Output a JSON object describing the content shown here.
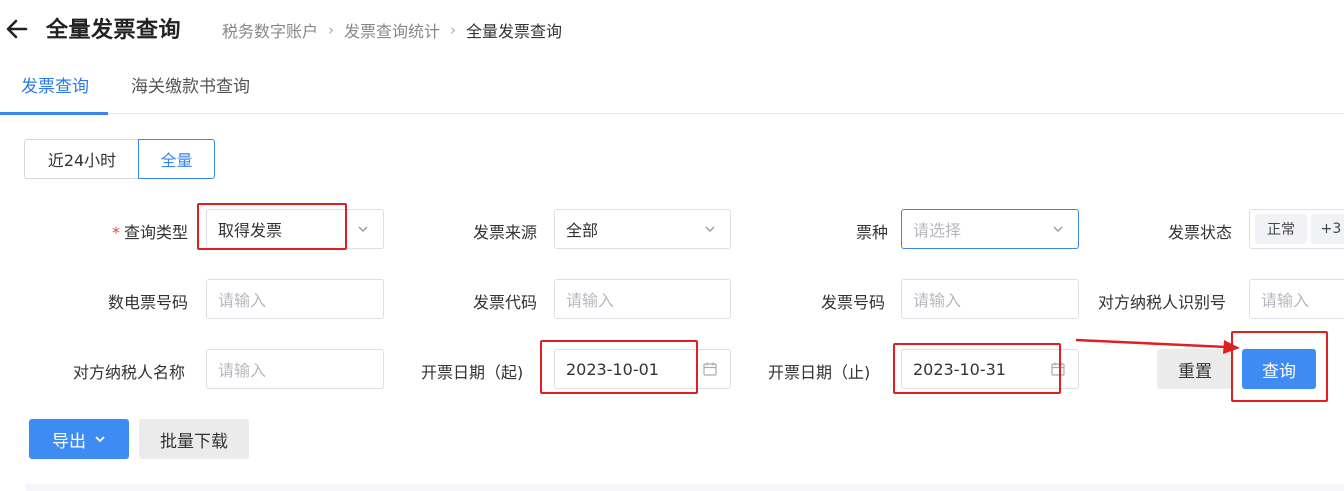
{
  "header": {
    "title": "全量发票查询",
    "breadcrumb": [
      "税务数字账户",
      "发票查询统计",
      "全量发票查询"
    ]
  },
  "tabs": [
    {
      "label": "发票查询",
      "active": true
    },
    {
      "label": "海关缴款书查询",
      "active": false
    }
  ],
  "time_range": {
    "options": [
      "近24小时",
      "全量"
    ],
    "selected": "全量"
  },
  "form": {
    "query_type": {
      "label": "查询类型",
      "required": true,
      "value": "取得发票"
    },
    "invoice_source": {
      "label": "发票来源",
      "value": "全部"
    },
    "ticket_type": {
      "label": "票种",
      "placeholder": "请选择"
    },
    "invoice_status": {
      "label": "发票状态",
      "tags": [
        "正常",
        "+3"
      ]
    },
    "e_invoice_no": {
      "label": "数电票号码",
      "placeholder": "请输入"
    },
    "invoice_code": {
      "label": "发票代码",
      "placeholder": "请输入"
    },
    "invoice_no": {
      "label": "发票号码",
      "placeholder": "请输入"
    },
    "counterparty_tax_id": {
      "label": "对方纳税人识别号",
      "placeholder": "请输入"
    },
    "counterparty_name": {
      "label": "对方纳税人名称",
      "placeholder": "请输入"
    },
    "issue_date_start": {
      "label": "开票日期（起)",
      "value": "2023-10-01"
    },
    "issue_date_end": {
      "label": "开票日期（止)",
      "value": "2023-10-31"
    }
  },
  "buttons": {
    "reset": "重置",
    "query": "查询",
    "export": "导出",
    "batch_download": "批量下载"
  },
  "colors": {
    "accent": "#3f8bf4",
    "highlight": "#e02020"
  }
}
